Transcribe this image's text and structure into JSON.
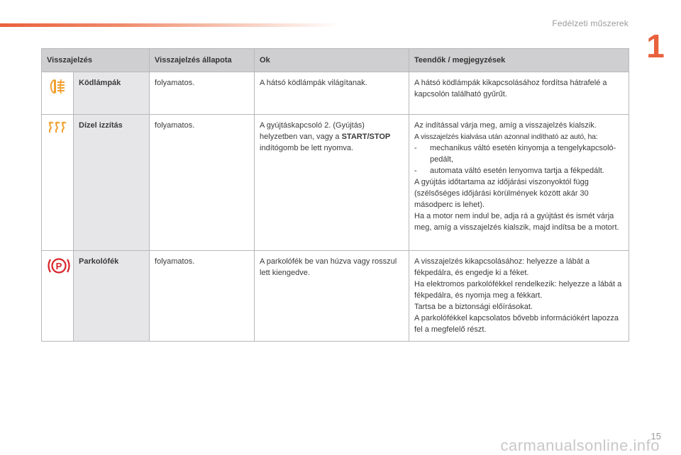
{
  "header": {
    "section_title": "Fedélzeti műszerek",
    "chapter_number": "1"
  },
  "table": {
    "columns": [
      "Visszajelzés",
      "Visszajelzés állapota",
      "Ok",
      "Teendők / megjegyzések"
    ],
    "rows": [
      {
        "icon": "rear-fog-lamp-icon",
        "name": "Ködlámpák",
        "state": "folyamatos.",
        "cause": "A hátsó ködlámpák világítanak.",
        "notes": [
          "A hátsó ködlámpák kikapcsolásához fordítsa hátrafelé a kapcsolón található gyűrűt."
        ]
      },
      {
        "icon": "diesel-preheating-icon",
        "name": "Dízel izzítás",
        "state": "folyamatos.",
        "cause_pre": "A gyújtáskapcsoló 2. (Gyújtás) helyzetben van, vagy a ",
        "cause_bold": "START/STOP",
        "cause_post": " indítógomb be lett nyomva.",
        "notes": [
          "Az indítással várja meg, amíg a visszajelzés kialszik.",
          "A visszajelzés kialvása után azonnal indítható az autó, ha:",
          "-\tmechanikus váltó esetén kinyomja a tengelykapcsoló-pedált,",
          "-\tautomata váltó esetén lenyomva tartja a fékpedált.",
          "A gyújtás időtartama az időjárási viszonyoktól függ (szélsőséges időjárási körülmények között akár 30 másodperc is lehet).",
          "Ha a motor nem indul be, adja rá a gyújtást és ismét várja meg, amíg a visszajelzés kialszik, majd indítsa be a motort."
        ]
      },
      {
        "icon": "parking-brake-icon",
        "name": "Parkolófék",
        "state": "folyamatos.",
        "cause": "A parkolófék be van húzva vagy rosszul lett kiengedve.",
        "notes": [
          "A visszajelzés kikapcsolásához: helyezze a lábát a fékpedálra, és engedje ki a féket.",
          "Ha elektromos parkolófékkel rendelkezik: helyezze a lábát a fékpedálra, és nyomja meg a fékkart.",
          "Tartsa be a biztonsági előírásokat.",
          "A parkolófékkel kapcsolatos bővebb információkért lapozza fel a megfelelő részt."
        ]
      }
    ]
  },
  "footer": {
    "page_number": "15",
    "watermark": "carmanualsonline.info"
  },
  "colors": {
    "accent": "#e8603c",
    "header_row": "#cfcfd1",
    "name_cell": "#e6e6e8",
    "icon_orange": "#f0a030",
    "icon_red": "#d8232a"
  }
}
